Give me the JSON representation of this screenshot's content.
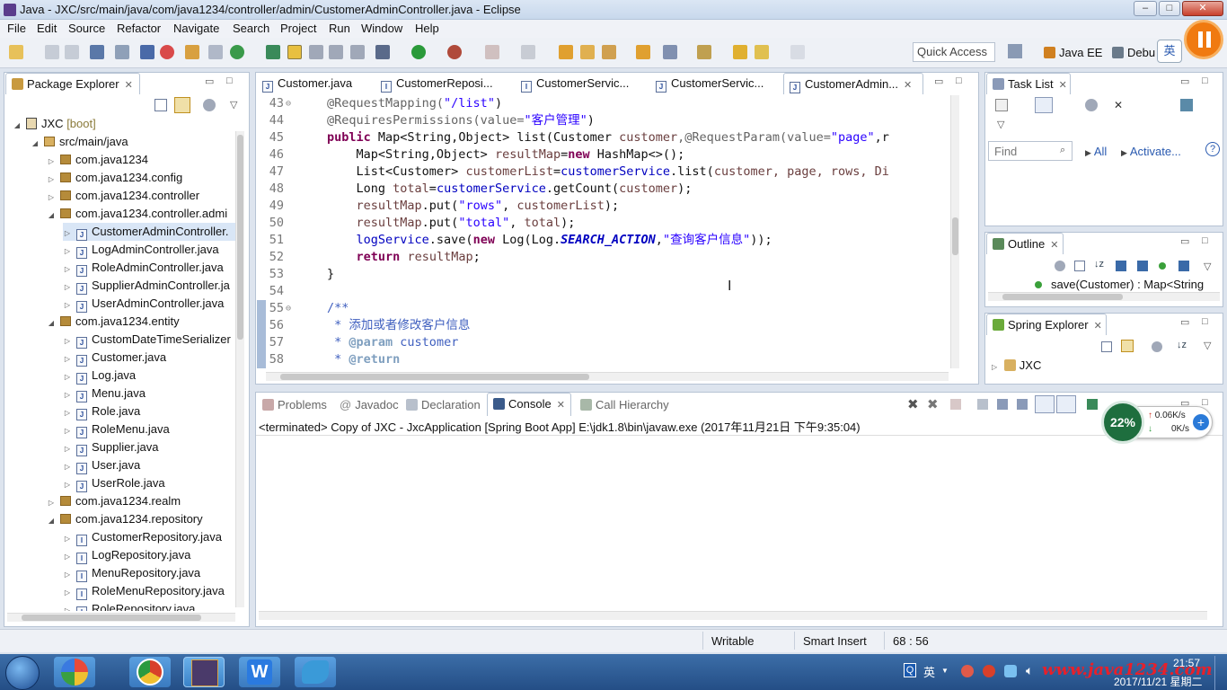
{
  "window": {
    "title": "Java - JXC/src/main/java/com/java1234/controller/admin/CustomerAdminController.java - Eclipse",
    "min": "–",
    "max": "□",
    "close": "✕"
  },
  "menu": [
    "File",
    "Edit",
    "Source",
    "Refactor",
    "Navigate",
    "Search",
    "Project",
    "Run",
    "Window",
    "Help"
  ],
  "toolbar": {
    "quick_access": "Quick Access",
    "perspective_java_ee": "Java EE",
    "perspective_debug": "Debu",
    "ime": "英"
  },
  "package_explorer": {
    "title": "Package Explorer",
    "items": [
      {
        "label": "JXC",
        "suffix": "[boot]"
      },
      {
        "label": "src/main/java"
      },
      {
        "label": "com.java1234"
      },
      {
        "label": "com.java1234.config"
      },
      {
        "label": "com.java1234.controller"
      },
      {
        "label": "com.java1234.controller.admi"
      },
      {
        "label": "CustomerAdminController."
      },
      {
        "label": "LogAdminController.java"
      },
      {
        "label": "RoleAdminController.java"
      },
      {
        "label": "SupplierAdminController.ja"
      },
      {
        "label": "UserAdminController.java"
      },
      {
        "label": "com.java1234.entity"
      },
      {
        "label": "CustomDateTimeSerializer"
      },
      {
        "label": "Customer.java"
      },
      {
        "label": "Log.java"
      },
      {
        "label": "Menu.java"
      },
      {
        "label": "Role.java"
      },
      {
        "label": "RoleMenu.java"
      },
      {
        "label": "Supplier.java"
      },
      {
        "label": "User.java"
      },
      {
        "label": "UserRole.java"
      },
      {
        "label": "com.java1234.realm"
      },
      {
        "label": "com.java1234.repository"
      },
      {
        "label": "CustomerRepository.java"
      },
      {
        "label": "LogRepository.java"
      },
      {
        "label": "MenuRepository.java"
      },
      {
        "label": "RoleMenuRepository.java"
      },
      {
        "label": "RoleRepository.java"
      }
    ]
  },
  "editor_tabs": [
    "Customer.java",
    "CustomerReposi...",
    "CustomerServic...",
    "CustomerServic...",
    "CustomerAdmin..."
  ],
  "code": {
    "lines": [
      "43",
      "44",
      "45",
      "46",
      "47",
      "48",
      "49",
      "50",
      "51",
      "52",
      "53",
      "54",
      "55",
      "56",
      "57",
      "58"
    ],
    "l43a": "@RequestMapping(",
    "l43b": "\"/list\"",
    "l43c": ")",
    "l44a": "@RequiresPermissions(value=",
    "l44b": "\"客户管理\"",
    "l44c": ")",
    "l45a": "public",
    "l45b": " Map<String,Object> list(Customer ",
    "l45c": "customer",
    "l45d": ",@RequestParam(value=",
    "l45e": "\"page\"",
    "l45f": ",r",
    "l46a": "    Map<String,Object> ",
    "l46b": "resultMap",
    "l46c": "=",
    "l46d": "new",
    "l46e": " HashMap<>();",
    "l47a": "    List<Customer> ",
    "l47b": "customerList",
    "l47c": "=",
    "l47d": "customerService",
    "l47e": ".list(",
    "l47f": "customer, page, rows, Di",
    "l48a": "    Long ",
    "l48b": "total",
    "l48c": "=",
    "l48d": "customerService",
    "l48e": ".getCount(",
    "l48f": "customer",
    "l48g": ");",
    "l49a": "    ",
    "l49b": "resultMap",
    "l49c": ".put(",
    "l49d": "\"rows\"",
    "l49e": ", ",
    "l49f": "customerList",
    "l49g": ");",
    "l50a": "    ",
    "l50b": "resultMap",
    "l50c": ".put(",
    "l50d": "\"total\"",
    "l50e": ", ",
    "l50f": "total",
    "l50g": ");",
    "l51a": "    ",
    "l51b": "logService",
    "l51c": ".save(",
    "l51d": "new",
    "l51e": " Log(Log.",
    "l51f": "SEARCH_ACTION",
    "l51g": ",",
    "l51h": "\"查询客户信息\"",
    "l51i": "));",
    "l52a": "    ",
    "l52b": "return",
    "l52c": " ",
    "l52d": "resultMap",
    "l52e": ";",
    "l53a": "}",
    "l55a": "/**",
    "l56a": " * 添加或者修改客户信息",
    "l57a": " * ",
    "l57b": "@param",
    "l57c": " customer",
    "l58a": " * ",
    "l58b": "@return"
  },
  "task_list": {
    "title": "Task List",
    "find_placeholder": "Find",
    "all": "All",
    "activate": "Activate..."
  },
  "outline": {
    "title": "Outline",
    "item": "save(Customer) : Map<String"
  },
  "spring_explorer": {
    "title": "Spring Explorer",
    "item": "JXC"
  },
  "console": {
    "tabs": [
      "Problems",
      "Javadoc",
      "Declaration",
      "Console",
      "Call Hierarchy"
    ],
    "status": "<terminated> Copy of JXC - JxcApplication [Spring Boot App] E:\\jdk1.8\\bin\\javaw.exe (2017年11月21日 下午9:35:04)"
  },
  "netmeter": {
    "percent": "22%",
    "up": "0.06K/s",
    "down": "0K/s"
  },
  "statusbar": {
    "writable": "Writable",
    "insert": "Smart Insert",
    "position": "68 : 56"
  },
  "taskbar": {
    "time": "21:57",
    "date": "2017/11/21 星期二",
    "watermark": "www.java1234.com",
    "ime": "英"
  }
}
